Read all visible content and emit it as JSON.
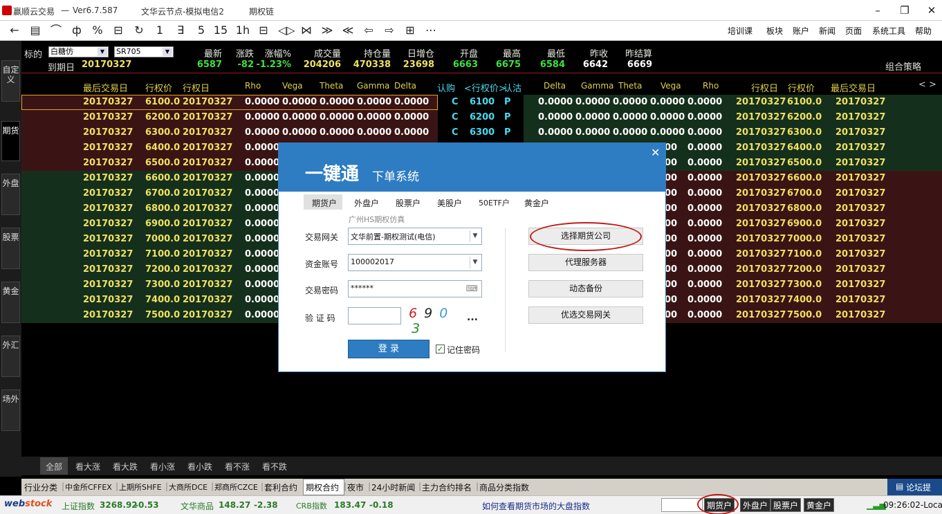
{
  "window": {
    "app": "赢顺云交易",
    "separator": "—",
    "version": "Ver6.7.587",
    "node": "文华云节点-模拟电信2",
    "page": "期权链"
  },
  "window_controls": {
    "minimize": "–",
    "restore": "❐",
    "close": "✕"
  },
  "toolbar": {
    "icons": [
      "arrow-left-icon",
      "list-icon",
      "line-chart-icon",
      "candle-icon",
      "formula-icon",
      "save-icon",
      "refresh-icon",
      "period-1",
      "period-3",
      "period-5",
      "period-15",
      "period-1h",
      "period-day",
      "split-icon",
      "cross-icon",
      "chevron-double-down-icon",
      "chevron-double-up-icon",
      "arrow-left-outline-icon",
      "arrow-right-outline-icon",
      "grid-icon",
      "more-icon"
    ],
    "glyphs": [
      "←",
      "▤",
      "⌒",
      "ф",
      "%",
      "⊟",
      "↻",
      "1",
      "∃",
      "5",
      "15",
      "1h",
      "⊟",
      "◁▷",
      "⋈",
      "≫",
      "≪",
      "⇦",
      "⇨",
      "⊞",
      "⋯"
    ],
    "menus": [
      "培训课",
      "板块",
      "账户",
      "新闻",
      "页面",
      "系统工具",
      "帮助"
    ]
  },
  "left_tabs": [
    "自定义",
    "期货",
    "外盘",
    "股票",
    "黄金",
    "外汇",
    "场外"
  ],
  "header": {
    "target_label": "标的",
    "target_value": "白糖仿",
    "contract_value": "SR705",
    "expiry_label": "到期日",
    "expiry_value": "20170327",
    "fields": [
      {
        "label": "最新",
        "value": "6587",
        "color": "#3ee03e"
      },
      {
        "label": "涨跌",
        "value": "-82",
        "color": "#3ee03e"
      },
      {
        "label": "涨幅%",
        "value": "-1.23%",
        "color": "#3ee03e"
      },
      {
        "label": "成交量",
        "value": "204206",
        "color": "#f0e060"
      },
      {
        "label": "持仓量",
        "value": "470338",
        "color": "#f0e060"
      },
      {
        "label": "日增仓",
        "value": "23698",
        "color": "#f0e060"
      },
      {
        "label": "开盘",
        "value": "6663",
        "color": "#3ee03e"
      },
      {
        "label": "最高",
        "value": "6675",
        "color": "#3ee03e"
      },
      {
        "label": "最低",
        "value": "6584",
        "color": "#3ee03e"
      },
      {
        "label": "昨收",
        "value": "6642",
        "color": "#ffffff"
      },
      {
        "label": "昨结算",
        "value": "6669",
        "color": "#ffffff"
      }
    ],
    "strategy_link": "组合策略"
  },
  "table": {
    "columns": [
      "最后交易日",
      "行权价",
      "行权日",
      "Rho",
      "Vega",
      "Theta",
      "Gamma",
      "Delta",
      "认购",
      "<行权价>",
      "认沽",
      "Delta",
      "Gamma",
      "Theta",
      "Vega",
      "Rho",
      "行权日",
      "行权价",
      "最后交易日"
    ],
    "scroll_arrows": "< >",
    "rows": [
      {
        "last": "20170327",
        "strike": "6100.0",
        "ex": "20170327",
        "greek": "0.0000",
        "call": "C",
        "mid": "6100",
        "put": "P"
      },
      {
        "last": "20170327",
        "strike": "6200.0",
        "ex": "20170327",
        "greek": "0.0000",
        "call": "C",
        "mid": "6200",
        "put": "P"
      },
      {
        "last": "20170327",
        "strike": "6300.0",
        "ex": "20170327",
        "greek": "0.0000",
        "call": "C",
        "mid": "6300",
        "put": "P"
      },
      {
        "last": "20170327",
        "strike": "6400.0",
        "ex": "20170327",
        "greek": "0.0000",
        "call": "",
        "mid": "",
        "put": ""
      },
      {
        "last": "20170327",
        "strike": "6500.0",
        "ex": "20170327",
        "greek": "0.0000",
        "call": "",
        "mid": "",
        "put": ""
      },
      {
        "last": "20170327",
        "strike": "6600.0",
        "ex": "20170327",
        "greek": "0.0000",
        "call": "",
        "mid": "",
        "put": ""
      },
      {
        "last": "20170327",
        "strike": "6700.0",
        "ex": "20170327",
        "greek": "0.0000",
        "call": "",
        "mid": "",
        "put": ""
      },
      {
        "last": "20170327",
        "strike": "6800.0",
        "ex": "20170327",
        "greek": "0.0000",
        "call": "",
        "mid": "",
        "put": ""
      },
      {
        "last": "20170327",
        "strike": "6900.0",
        "ex": "20170327",
        "greek": "0.0000",
        "call": "",
        "mid": "",
        "put": ""
      },
      {
        "last": "20170327",
        "strike": "7000.0",
        "ex": "20170327",
        "greek": "0.0000",
        "call": "",
        "mid": "",
        "put": ""
      },
      {
        "last": "20170327",
        "strike": "7100.0",
        "ex": "20170327",
        "greek": "0.0000",
        "call": "",
        "mid": "",
        "put": ""
      },
      {
        "last": "20170327",
        "strike": "7200.0",
        "ex": "20170327",
        "greek": "0.0000",
        "call": "",
        "mid": "",
        "put": ""
      },
      {
        "last": "20170327",
        "strike": "7300.0",
        "ex": "20170327",
        "greek": "0.0000",
        "call": "",
        "mid": "",
        "put": ""
      },
      {
        "last": "20170327",
        "strike": "7400.0",
        "ex": "20170327",
        "greek": "0.0000",
        "call": "",
        "mid": "",
        "put": ""
      },
      {
        "last": "20170327",
        "strike": "7500.0",
        "ex": "20170327",
        "greek": "0.0000",
        "call": "",
        "mid": "",
        "put": ""
      }
    ],
    "partial_right": "00",
    "colors": {
      "itm": "#3a1414",
      "otm": "#14301c"
    }
  },
  "dialog": {
    "title": "一键通",
    "subtitle": "下单系统",
    "close": "✕",
    "tabs": [
      "期货户",
      "外盘户",
      "股票户",
      "美股户",
      "50ETF户",
      "黄金户"
    ],
    "broker": "广州HS期权仿真",
    "gateway_label": "交易网关",
    "gateway_value": "文华前置-期权测试(电信)",
    "account_label": "资金账号",
    "account_value": "100002017",
    "password_label": "交易密码",
    "password_value": "******",
    "captcha_label": "验 证 码",
    "captcha_digits": [
      "6",
      "9",
      "0",
      "3"
    ],
    "captcha_more": "...",
    "login_button": "登 录",
    "remember_label": "记住密码",
    "side_buttons": [
      "选择期货公司",
      "代理服务器",
      "动态备份",
      "优选交易网关"
    ]
  },
  "filter_tabs": [
    "全部",
    "看大涨",
    "看大跌",
    "看小涨",
    "看小跌",
    "看不涨",
    "看不跌"
  ],
  "category_tabs": [
    "行业分类",
    "中金所CFFEX",
    "上期所SHFE",
    "大商所DCE",
    "郑商所CZCE",
    "套利合约",
    "期权合约",
    "夜市",
    "24小时新闻",
    "主力合约排名",
    "商品分类指数"
  ],
  "category_active": "期权合约",
  "forum": "论坛提",
  "status": {
    "logo_a": "web",
    "logo_b": "stock",
    "indices": [
      {
        "name": "上证指数",
        "value": "3268.92",
        "change": "-0.53"
      },
      {
        "name": "文华商品",
        "value": "148.27",
        "change": "-2.38"
      },
      {
        "name": "CRB指数",
        "value": "183.47",
        "change": "-0.18"
      }
    ],
    "news": "如何查看期货市场的大盘指数",
    "accounts": [
      "期货户",
      "外盘户",
      "股票户",
      "黄金户"
    ],
    "time": "09:26:02-Loca"
  }
}
